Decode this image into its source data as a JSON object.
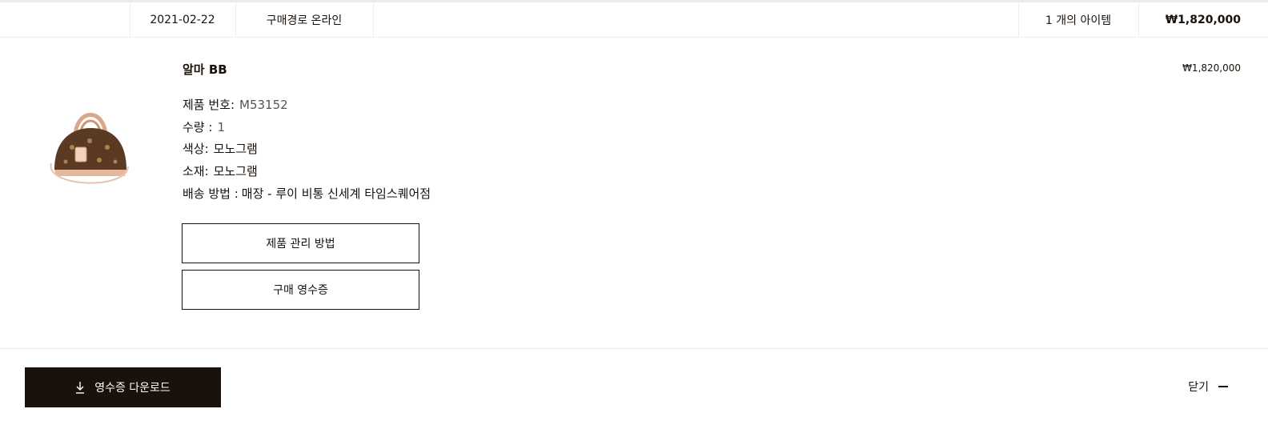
{
  "order": {
    "date": "2021-02-22",
    "channel": "구매경로  온라인",
    "item_count": "1 개의 아이템",
    "total": "₩1,820,000"
  },
  "item": {
    "name": "알마 BB",
    "price": "₩1,820,000",
    "attributes": [
      {
        "label": "제품 번호:",
        "value": "M53152"
      },
      {
        "label": "수량 :",
        "value": "1"
      },
      {
        "label": "색상:",
        "value": "모노그램"
      },
      {
        "label": "소재:",
        "value": "모노그램"
      },
      {
        "label": "배송 방법 :",
        "value": "매장 - 루이 비통 신세계 타임스퀘어점"
      }
    ],
    "care_button": "제품 관리 방법",
    "receipt_button": "구매 영수증"
  },
  "footer": {
    "download_label": "영수증 다운로드",
    "close_label": "닫기"
  }
}
